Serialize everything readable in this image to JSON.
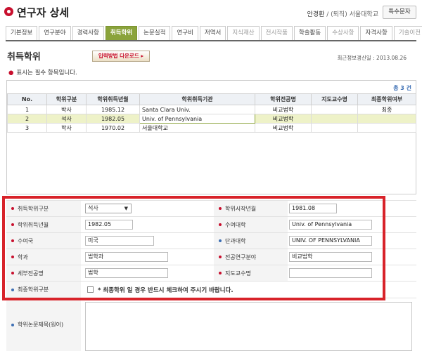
{
  "header": {
    "title": "연구자 상세",
    "user_name": "안경환",
    "user_affiliation": " / (퇴직) 서울대학교",
    "special_button": "특수문자"
  },
  "tabs": [
    {
      "label": "기본정보",
      "state": "normal"
    },
    {
      "label": "연구분야",
      "state": "normal"
    },
    {
      "label": "경력사항",
      "state": "normal"
    },
    {
      "label": "취득학위",
      "state": "active"
    },
    {
      "label": "논문실적",
      "state": "normal"
    },
    {
      "label": "연구비",
      "state": "normal"
    },
    {
      "label": "저역서",
      "state": "normal"
    },
    {
      "label": "지식재산",
      "state": "dim"
    },
    {
      "label": "전시작품",
      "state": "dim"
    },
    {
      "label": "학술활동",
      "state": "normal"
    },
    {
      "label": "수상사항",
      "state": "dim"
    },
    {
      "label": "자격사항",
      "state": "normal"
    },
    {
      "label": "기술이전",
      "state": "dim"
    }
  ],
  "section": {
    "title": "취득학위",
    "download_button": "입력방법 다운로드 ▸",
    "recent_update": "최근정보갱신일 :   2013.08.26",
    "required_note": "표시는 필수 항목입니다."
  },
  "table": {
    "total": "총 3 건",
    "headers": [
      "No.",
      "학위구분",
      "학위취득년월",
      "학위취득기관",
      "학위전공명",
      "지도교수명",
      "최종학위여부"
    ],
    "rows": [
      {
        "no": "1",
        "degree": "박사",
        "date": "1985.12",
        "institution": "Santa Clara Univ.",
        "major": "비교법학",
        "advisor": "",
        "final": "최종",
        "selected": false
      },
      {
        "no": "2",
        "degree": "석사",
        "date": "1982.05",
        "institution": "Univ. of Pennsylvania",
        "major": "비교법학",
        "advisor": "",
        "final": "",
        "selected": true
      },
      {
        "no": "3",
        "degree": "학사",
        "date": "1970.02",
        "institution": "서울대학교",
        "major": "비교법학",
        "advisor": "",
        "final": "",
        "selected": false
      }
    ]
  },
  "form": {
    "degree_type_label": "취득학위구분",
    "degree_type_value": "석사",
    "start_date_label": "학위시작년월",
    "start_date_value": "1981.08",
    "acquired_date_label": "학위취득년월",
    "acquired_date_value": "1982.05",
    "university_label": "수여대학",
    "university_value": "Univ. of Pennsylvania",
    "country_label": "수여국",
    "country_value": "미국",
    "college_label": "단과대학",
    "college_value": "UNIV. OF PENNSYLVANIA",
    "department_label": "학과",
    "department_value": "법학과",
    "research_field_label": "전공연구분야",
    "research_field_value": "비교법학",
    "detail_major_label": "세부전공명",
    "detail_major_value": "법학",
    "advisor_label": "지도교수명",
    "advisor_value": "",
    "final_degree_label": "최종학위구분",
    "final_degree_note": "* 최종학위 일 경우 반드시 체크하여 주시기 바랍니다.",
    "thesis_label": "학위논문제목(원어)",
    "thesis_value": ""
  },
  "colors": {
    "accent_green": "#8aa33b",
    "required_red": "#c8102e",
    "optional_blue": "#3d6fb4",
    "highlight_frame": "#d8232a"
  }
}
